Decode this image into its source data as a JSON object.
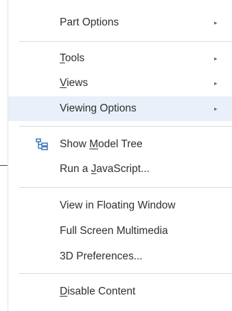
{
  "menu": {
    "part_options": {
      "label": "Part Options",
      "arrow": "▸"
    },
    "tools": {
      "prefix": "",
      "mnemonic": "T",
      "rest": "ools",
      "arrow": "▸"
    },
    "views": {
      "prefix": "",
      "mnemonic": "V",
      "rest": "iews",
      "arrow": "▸"
    },
    "viewing_options": {
      "label": "Viewing Options",
      "arrow": "▸",
      "highlighted": true
    },
    "show_model_tree": {
      "prefix": "Show ",
      "mnemonic": "M",
      "rest": "odel Tree",
      "icon": "model-tree-icon"
    },
    "run_javascript": {
      "prefix": "Run a ",
      "mnemonic": "J",
      "rest": "avaScript..."
    },
    "view_floating": {
      "label": "View in Floating Window"
    },
    "full_screen": {
      "label": "Full Screen Multimedia"
    },
    "preferences_3d": {
      "label": "3D Preferences..."
    },
    "disable_content": {
      "prefix": "",
      "mnemonic": "D",
      "rest": "isable Content"
    }
  },
  "colors": {
    "highlight": "#e9f0f9",
    "icon_blue": "#2f6db5",
    "text": "#2f2f2f",
    "separator": "#d9d9d9"
  }
}
